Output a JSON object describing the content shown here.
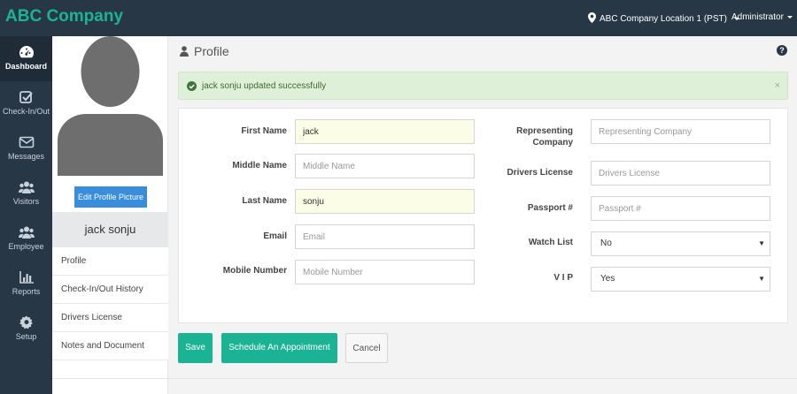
{
  "app": {
    "brand": "ABC Company"
  },
  "header": {
    "location": "ABC Company Location 1 (PST)",
    "user": "Administrator"
  },
  "sidebar": {
    "items": [
      {
        "label": "Dashboard",
        "icon": "dashboard-icon",
        "active": true
      },
      {
        "label": "Check-In/Out",
        "icon": "checkin-icon"
      },
      {
        "label": "Messages",
        "icon": "envelope-icon"
      },
      {
        "label": "Visitors",
        "icon": "users-icon"
      },
      {
        "label": "Employee",
        "icon": "users-icon"
      },
      {
        "label": "Reports",
        "icon": "bar-chart-icon"
      },
      {
        "label": "Setup",
        "icon": "gear-icon"
      }
    ]
  },
  "profile_panel": {
    "edit_picture_label": "Edit Profile Picture",
    "name": "jack sonju",
    "menu": [
      "Profile",
      "Check-In/Out History",
      "Drivers License",
      "Notes and Document"
    ]
  },
  "page": {
    "title": "Profile"
  },
  "alert": {
    "message": "jack sonju updated successfully",
    "close": "×"
  },
  "form": {
    "first_name": {
      "label": "First Name",
      "value": "jack",
      "placeholder": "First Name"
    },
    "middle_name": {
      "label": "Middle Name",
      "value": "",
      "placeholder": "Middle Name"
    },
    "last_name": {
      "label": "Last Name",
      "value": "sonju",
      "placeholder": "Last Name"
    },
    "email": {
      "label": "Email",
      "value": "",
      "placeholder": "Email"
    },
    "mobile": {
      "label": "Mobile Number",
      "value": "",
      "placeholder": "Mobile Number"
    },
    "representing_company": {
      "label_line1": "Representing",
      "label_line2": "Company",
      "value": "",
      "placeholder": "Representing Company"
    },
    "drivers_license": {
      "label": "Drivers License",
      "value": "",
      "placeholder": "Drivers License"
    },
    "passport": {
      "label": "Passport #",
      "value": "",
      "placeholder": "Passport #"
    },
    "watch_list": {
      "label": "Watch List",
      "value": "No"
    },
    "vip": {
      "label": "V I P",
      "value": "Yes"
    }
  },
  "actions": {
    "save": "Save",
    "schedule": "Schedule An Appointment",
    "cancel": "Cancel"
  },
  "colors": {
    "accent": "#1ab394",
    "nav_bg": "#283745",
    "link_blue": "#3a8ddb",
    "alert_bg": "#dff0d8"
  }
}
